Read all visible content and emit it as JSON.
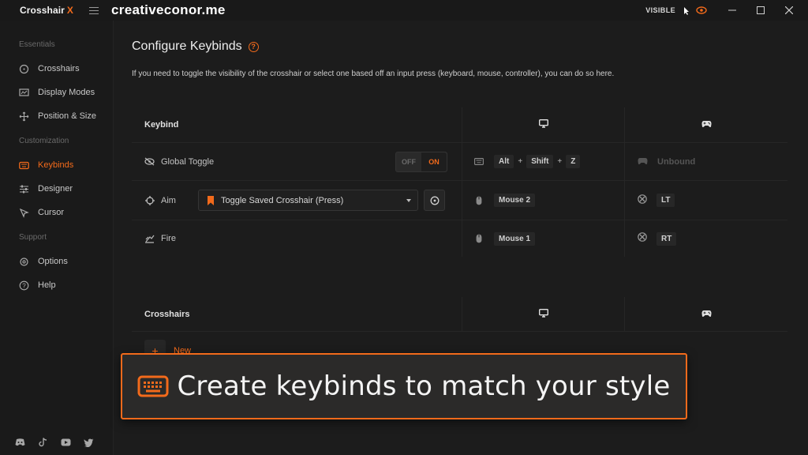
{
  "app": {
    "brand": "Crosshair",
    "brand_accent": "X",
    "watermark": "creativeconor.me",
    "accent_color": "#f26a1b"
  },
  "titlebar": {
    "visible_label": "VISIBLE"
  },
  "sidebar": {
    "sections": [
      {
        "label": "Essentials"
      },
      {
        "label": "Customization"
      },
      {
        "label": "Support"
      }
    ],
    "items": [
      {
        "label": "Crosshairs",
        "icon": "crosshair-icon"
      },
      {
        "label": "Display Modes",
        "icon": "display-modes-icon"
      },
      {
        "label": "Position & Size",
        "icon": "move-icon"
      },
      {
        "label": "Keybinds",
        "icon": "keyboard-icon",
        "active": true
      },
      {
        "label": "Designer",
        "icon": "sliders-icon"
      },
      {
        "label": "Cursor",
        "icon": "cursor-icon"
      },
      {
        "label": "Options",
        "icon": "gear-icon"
      },
      {
        "label": "Help",
        "icon": "help-icon"
      }
    ],
    "social": [
      "discord-icon",
      "tiktok-icon",
      "youtube-icon",
      "twitter-icon"
    ]
  },
  "main": {
    "title": "Configure Keybinds",
    "description": "If you need to toggle the visibility of the crosshair or select one based off an input press (keyboard, mouse, controller), you can do so here.",
    "keybinds_table": {
      "header": {
        "col1": "Keybind"
      },
      "rows": [
        {
          "label": "Global Toggle",
          "toggle": {
            "off": "OFF",
            "on": "ON",
            "value": "ON"
          },
          "keyboard": [
            "Alt",
            "+",
            "Shift",
            "+",
            "Z"
          ],
          "controller": "Unbound"
        },
        {
          "label": "Aim",
          "select_value": "Toggle Saved Crosshair (Press)",
          "keyboard": [
            "Mouse 2"
          ],
          "controller": "LT"
        },
        {
          "label": "Fire",
          "keyboard": [
            "Mouse 1"
          ],
          "controller": "RT"
        }
      ]
    },
    "crosshairs_table": {
      "header": {
        "col1": "Crosshairs"
      },
      "new_label": "New"
    }
  },
  "banner": {
    "text": "Create keybinds to match your style"
  }
}
